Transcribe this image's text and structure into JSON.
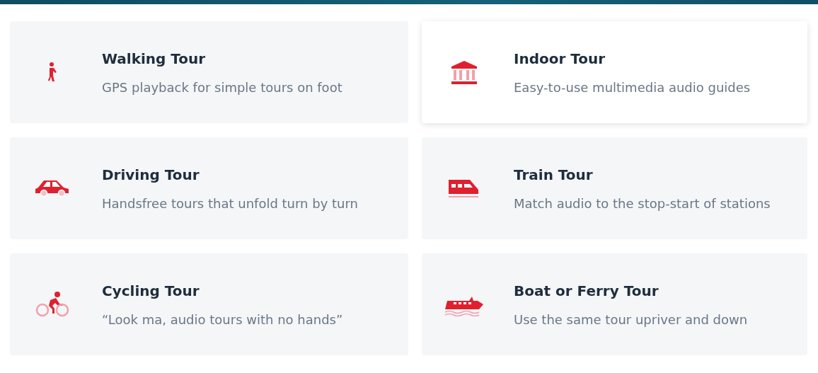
{
  "tours": [
    {
      "title": "Walking Tour",
      "description": "GPS playback for simple tours on foot",
      "selected": false
    },
    {
      "title": "Indoor Tour",
      "description": "Easy-to-use multimedia audio guides",
      "selected": true
    },
    {
      "title": "Driving Tour",
      "description": "Handsfree tours that unfold turn by turn",
      "selected": false
    },
    {
      "title": "Train Tour",
      "description": "Match audio to the stop-start of stations",
      "selected": false
    },
    {
      "title": "Cycling Tour",
      "description": "“Look ma, audio tours with no hands”",
      "selected": false
    },
    {
      "title": "Boat or Ferry Tour",
      "description": "Use the same tour upriver and down",
      "selected": false
    }
  ]
}
